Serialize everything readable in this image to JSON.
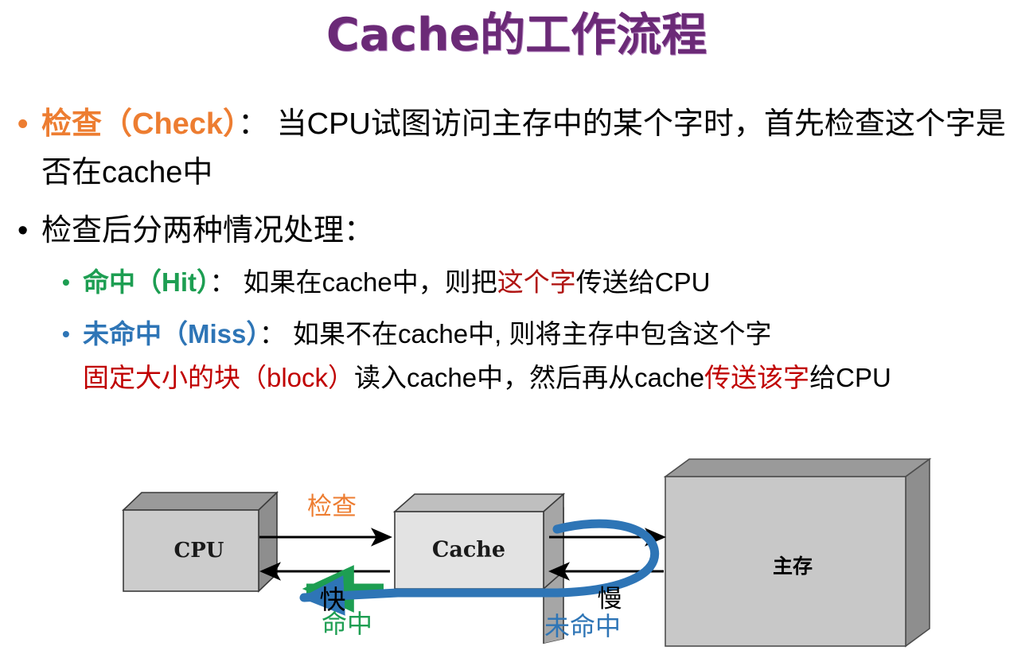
{
  "slide": {
    "title": "Cache的工作流程",
    "title_color": "#6b2a77"
  },
  "bullets": [
    {
      "level": 1,
      "marker": "•",
      "marker_color": "#ED7D31",
      "runs": [
        {
          "text": "检查（Check）",
          "color": "#ED7D31",
          "bold": true
        },
        {
          "text": "： 当CPU试图访问主存中的某个字时，首先检查这个字是否在cache中",
          "color": "#000000",
          "bold": false
        }
      ]
    },
    {
      "level": 1,
      "marker": "•",
      "marker_color": "#000000",
      "runs": [
        {
          "text": "检查后分两种情况处理：",
          "color": "#000000",
          "bold": false
        }
      ]
    },
    {
      "level": 2,
      "marker": "•",
      "marker_color": "#1D9E52",
      "runs": [
        {
          "text": "命中（Hit）",
          "color": "#1D9E52",
          "bold": true
        },
        {
          "text": "： 如果在cache中，则把",
          "color": "#000000",
          "bold": false
        },
        {
          "text": "这个字",
          "color": "#B01513",
          "bold": false
        },
        {
          "text": "传送给CPU",
          "color": "#000000",
          "bold": false
        }
      ]
    },
    {
      "level": 2,
      "marker": "•",
      "marker_color": "#2E75B6",
      "runs": [
        {
          "text": "未命中（Miss）",
          "color": "#2E75B6",
          "bold": true
        },
        {
          "text": "： 如果不在cache中, 则将主存中包含这个字",
          "color": "#000000",
          "bold": false
        },
        {
          "text": "固定大小的块（block）",
          "color": "#C00000",
          "bold": false
        },
        {
          "text": "读入cache中，然后再从cache",
          "color": "#000000",
          "bold": false
        },
        {
          "text": "传送该字",
          "color": "#C00000",
          "bold": false
        },
        {
          "text": "给CPU",
          "color": "#000000",
          "bold": false
        }
      ]
    }
  ],
  "text_lines": {
    "b1_part1": "检查（Check）",
    "b1_part2": "： 当CPU试图访问主存中的某个字时，首先检查这个字是否在cache中",
    "b2_text": "检查后分两种情况处理：",
    "b3_part1": "命中（Hit）",
    "b3_part2": "： 如果在cache中，则把",
    "b3_part3": "这个字",
    "b3_part4": "传送给CPU",
    "b4_part1": "未命中（Miss）",
    "b4_part2": "： 如果不在cache中, 则将主存中包含这个字",
    "b4_part3": "固定大小的块（block）",
    "b4_part4": "读入cache中，然后再从cache",
    "b4_part5": "传送该字",
    "b4_part6": "给CPU",
    "dot": "•"
  },
  "diagram": {
    "boxes": [
      {
        "id": "cpu",
        "label": "CPU",
        "face_color": "#CCCCCC",
        "top_color": "#9A9A9A",
        "side_color": "#8E8E8E"
      },
      {
        "id": "cache",
        "label": "Cache",
        "face_color": "#E3E3E3",
        "top_color": "#BFBFBF",
        "side_color": "#A6A6A6"
      },
      {
        "id": "memory",
        "label": "主存",
        "face_color": "#C8C8C8",
        "top_color": "#9A9A9A",
        "side_color": "#8E8E8E"
      }
    ],
    "labels": {
      "check": "检查",
      "check_color": "#ED7D31",
      "fast": "快",
      "fast_color": "#000000",
      "hit": "命中",
      "hit_color": "#1D9E52",
      "slow": "慢",
      "slow_color": "#000000",
      "miss": "未命中",
      "miss_color": "#2E75B6"
    },
    "arrow_colors": {
      "request": "#000000",
      "hit_path": "#1D9E52",
      "miss_path": "#2E75B6"
    }
  }
}
